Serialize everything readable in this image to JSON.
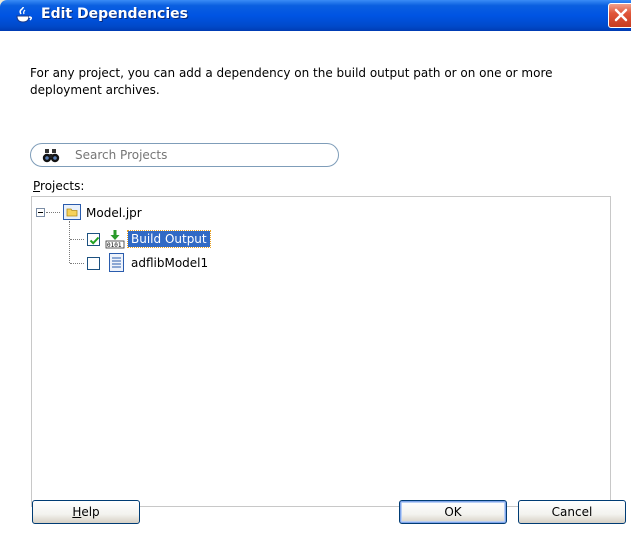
{
  "window": {
    "title": "Edit Dependencies",
    "titlebar_color": "#0054e3"
  },
  "description": "For any project, you can add a dependency on the build output path or on one or more deployment archives.",
  "search": {
    "placeholder": "Search Projects",
    "value": ""
  },
  "projects_label": {
    "mnemonic": "P",
    "rest": "rojects:"
  },
  "tree": {
    "root": {
      "label": "Model.jpr",
      "expanded": true,
      "icon": "project-folder-icon"
    },
    "children": [
      {
        "label": "Build Output",
        "checked": true,
        "selected": true,
        "icon": "build-output-icon"
      },
      {
        "label": "adflibModel1",
        "checked": false,
        "selected": false,
        "icon": "archive-document-icon"
      }
    ]
  },
  "buttons": {
    "help_mnemonic": "H",
    "help_rest": "elp",
    "ok": "OK",
    "cancel": "Cancel"
  },
  "colors": {
    "selection": "#316ac5",
    "dialog_bg": "#ece9d8"
  }
}
